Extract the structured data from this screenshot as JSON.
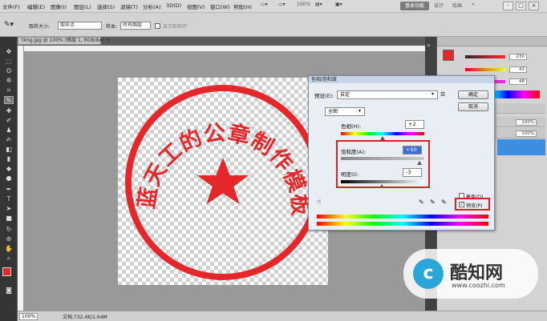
{
  "menu": [
    "文件(F)",
    "编辑(E)",
    "图像(I)",
    "图层(L)",
    "选择(S)",
    "滤镜(T)",
    "分析(A)",
    "3D(D)",
    "视图(V)",
    "窗口(W)",
    "帮助(H)"
  ],
  "topbar": {
    "zoom": "100%",
    "workspace": "基本功能",
    "design": "设计",
    "paint": "绘画"
  },
  "window_controls": [
    "-",
    "□",
    "×"
  ],
  "options": {
    "sample_size_label": "取样大小:",
    "sample_size_value": "取样点",
    "sample_label": "样本:",
    "sample_value": "所有图层",
    "show_ring": "显示取样环"
  },
  "document": {
    "tab": "timg.jpg @ 100% (图层 1, RGB/8#)",
    "close": "×"
  },
  "status": {
    "zoom": "100%",
    "doc_size": "文档:732.4K/1.64M"
  },
  "stamp": {
    "text": "蓝天工的公章制作模板",
    "color": "#e5262a"
  },
  "color_panel": {
    "values": [
      "230",
      "42",
      "48"
    ]
  },
  "layers_panel": {
    "opacity": "100%",
    "fill": "100%"
  },
  "dialog": {
    "title": "色相/饱和度",
    "preset_label": "预设(E):",
    "preset_value": "自定",
    "ok": "确定",
    "cancel": "取消",
    "channel": "全图",
    "hue_label": "色相(H):",
    "hue_value": "+2",
    "saturation_label": "饱和度(A):",
    "saturation_value": "+50",
    "lightness_label": "明度(I):",
    "lightness_value": "-3",
    "colorize": "着色(O)",
    "preview": "预览(P)",
    "preview_checked": true,
    "colorize_checked": false
  },
  "watermark": {
    "brand": "酷知网",
    "url": "www.coozhi.com"
  }
}
